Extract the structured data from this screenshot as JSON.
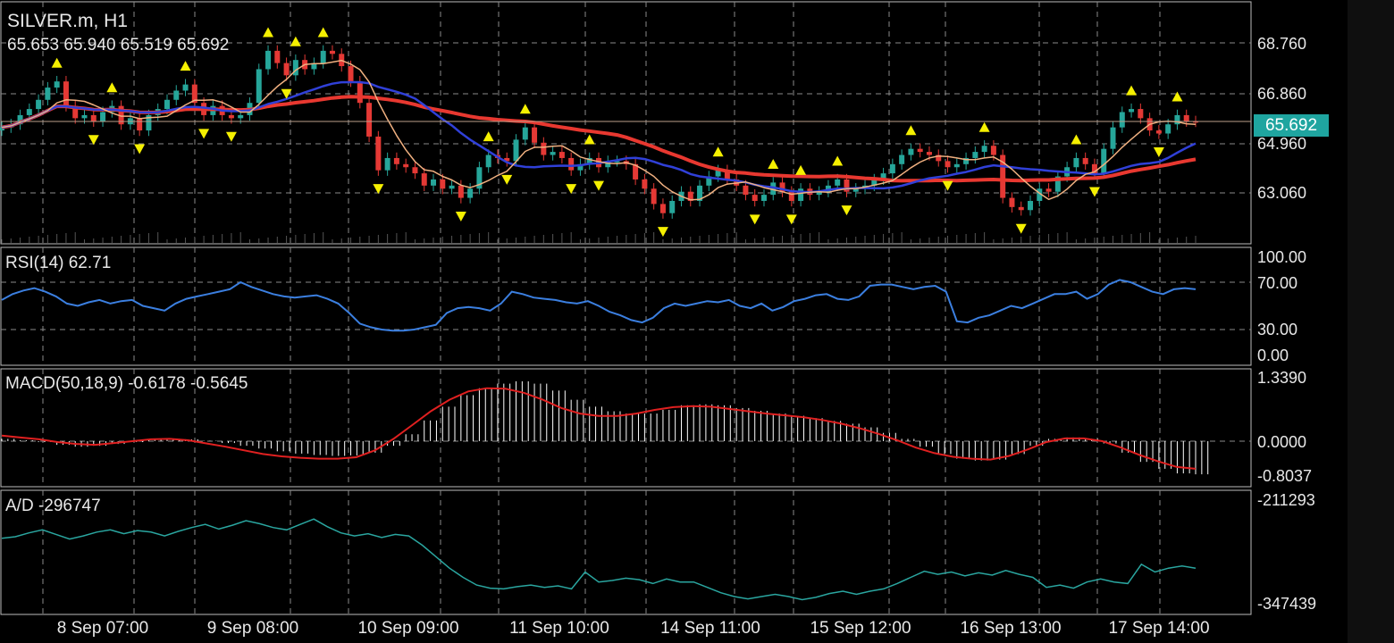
{
  "window": {
    "symbol": "SILVER.m, H1",
    "ohlc": "65.653 65.940 65.519 65.692"
  },
  "colors": {
    "background": "#000000",
    "grid": "#8a8a8a",
    "price_label_bg": "#1fa5a0",
    "rsi": "#3b7fe0",
    "macd_signal": "#e02020",
    "macd_hist": "#ffffff",
    "ad": "#2aa6a0",
    "ma_fast": "#f0b080",
    "ma_mid": "#3040d8",
    "ma_slow": "#e83830",
    "fractal": "#f5f000"
  },
  "main_panel": {
    "y_ticks": [
      "68.760",
      "66.860",
      "64.960",
      "63.060"
    ],
    "current_price": "65.692",
    "x_ticks": [
      "8 Sep 07:00",
      "9 Sep 08:00",
      "10 Sep 09:00",
      "11 Sep 10:00",
      "14 Sep 11:00",
      "15 Sep 12:00",
      "16 Sep 13:00",
      "17 Sep 14:00"
    ]
  },
  "rsi_panel": {
    "label": "RSI(14) 62.71",
    "y_ticks": [
      "100.00",
      "70.00",
      "30.00",
      "0.00"
    ]
  },
  "macd_panel": {
    "label": "MACD(50,18,9) -0.6178 -0.5645",
    "y_ticks": [
      "1.3390",
      "0.0000",
      "-0.8037"
    ]
  },
  "ad_panel": {
    "label": "A/D -296747",
    "y_ticks": [
      "-211293",
      "-347439"
    ]
  },
  "chart_data": {
    "type": "candlestick",
    "price_close": [
      65.5,
      65.6,
      65.9,
      66.1,
      66.4,
      66.8,
      67.0,
      66.2,
      65.8,
      65.9,
      65.7,
      66.0,
      66.2,
      65.6,
      65.8,
      65.4,
      65.9,
      66.1,
      66.4,
      66.7,
      66.9,
      66.3,
      65.9,
      66.2,
      65.9,
      65.8,
      65.9,
      66.3,
      67.4,
      68.0,
      67.6,
      67.2,
      67.7,
      67.4,
      67.6,
      68.0,
      67.9,
      67.5,
      67.0,
      66.3,
      65.2,
      64.1,
      64.5,
      64.3,
      64.2,
      64.0,
      63.6,
      63.8,
      63.5,
      63.6,
      63.2,
      63.5,
      64.2,
      64.6,
      64.5,
      64.4,
      65.1,
      65.5,
      65.0,
      64.6,
      64.7,
      64.5,
      64.1,
      64.3,
      64.5,
      64.2,
      64.4,
      64.4,
      64.3,
      63.8,
      63.5,
      63.0,
      62.7,
      63.1,
      63.4,
      63.1,
      63.6,
      63.9,
      64.1,
      63.8,
      63.6,
      63.3,
      63.1,
      63.3,
      63.7,
      63.4,
      63.1,
      63.5,
      63.3,
      63.4,
      63.6,
      63.8,
      63.4,
      63.5,
      63.6,
      63.8,
      64.0,
      64.3,
      64.6,
      64.8,
      64.7,
      64.6,
      64.4,
      64.2,
      64.3,
      64.5,
      64.7,
      64.9,
      64.6,
      63.2,
      62.9,
      62.8,
      63.1,
      63.5,
      63.4,
      63.9,
      64.2,
      64.5,
      64.3,
      64.0,
      64.8,
      65.5,
      66.0,
      66.1,
      65.8,
      65.4,
      65.3,
      65.6,
      65.9,
      65.7,
      65.69
    ],
    "rsi": [
      55,
      60,
      63,
      65,
      62,
      58,
      52,
      50,
      53,
      55,
      52,
      54,
      55,
      50,
      48,
      46,
      52,
      56,
      58,
      60,
      62,
      64,
      70,
      66,
      63,
      60,
      58,
      57,
      58,
      59,
      56,
      52,
      44,
      35,
      32,
      30,
      29,
      29,
      30,
      32,
      34,
      44,
      48,
      49,
      48,
      46,
      52,
      62,
      60,
      57,
      56,
      55,
      53,
      52,
      54,
      50,
      45,
      42,
      38,
      36,
      40,
      48,
      52,
      50,
      52,
      54,
      53,
      55,
      50,
      48,
      52,
      46,
      49,
      54,
      56,
      59,
      60,
      56,
      55,
      58,
      67,
      68,
      68,
      66,
      64,
      66,
      67,
      62,
      37,
      36,
      40,
      42,
      46,
      50,
      48,
      52,
      56,
      60,
      60,
      62,
      56,
      60,
      68,
      72,
      70,
      66,
      62,
      60,
      64,
      65,
      64
    ],
    "macd_hist": [
      0.05,
      0.02,
      -0.02,
      -0.08,
      -0.12,
      -0.1,
      -0.06,
      -0.02,
      0.03,
      0.05,
      0.04,
      0.01,
      -0.04,
      -0.1,
      -0.16,
      -0.22,
      -0.27,
      -0.3,
      -0.32,
      -0.31,
      -0.25,
      -0.1,
      0.15,
      0.45,
      0.75,
      1.0,
      1.15,
      1.25,
      1.3,
      1.25,
      1.1,
      0.9,
      0.75,
      0.65,
      0.6,
      0.6,
      0.68,
      0.78,
      0.8,
      0.78,
      0.72,
      0.66,
      0.6,
      0.55,
      0.5,
      0.44,
      0.38,
      0.3,
      0.18,
      0.05,
      -0.12,
      -0.28,
      -0.38,
      -0.42,
      -0.4,
      -0.28,
      -0.1,
      0.05,
      0.08,
      0.05,
      -0.05,
      -0.25,
      -0.45,
      -0.6,
      -0.7,
      -0.72
    ],
    "macd_signal": [
      0.12,
      0.08,
      0.04,
      -0.02,
      -0.06,
      -0.08,
      -0.04,
      0.0,
      0.04,
      0.05,
      0.02,
      -0.05,
      -0.12,
      -0.2,
      -0.28,
      -0.33,
      -0.36,
      -0.38,
      -0.38,
      -0.35,
      -0.2,
      0.05,
      0.35,
      0.65,
      0.9,
      1.08,
      1.15,
      1.14,
      1.05,
      0.9,
      0.72,
      0.6,
      0.55,
      0.55,
      0.6,
      0.68,
      0.74,
      0.76,
      0.75,
      0.7,
      0.65,
      0.6,
      0.56,
      0.52,
      0.46,
      0.38,
      0.28,
      0.16,
      0.02,
      -0.14,
      -0.26,
      -0.34,
      -0.38,
      -0.4,
      -0.32,
      -0.18,
      -0.02,
      0.06,
      0.06,
      0.0,
      -0.14,
      -0.3,
      -0.44,
      -0.56,
      -0.6
    ],
    "ad": [
      -261000,
      -259000,
      -254000,
      -250000,
      -256000,
      -262000,
      -258000,
      -253000,
      -250000,
      -255000,
      -251000,
      -253000,
      -258000,
      -252000,
      -247000,
      -243000,
      -249000,
      -244000,
      -238000,
      -242000,
      -247000,
      -250000,
      -243000,
      -236000,
      -246000,
      -254000,
      -258000,
      -255000,
      -260000,
      -256000,
      -258000,
      -270000,
      -285000,
      -300000,
      -312000,
      -322000,
      -326000,
      -327000,
      -324000,
      -322000,
      -325000,
      -323000,
      -327000,
      -305000,
      -318000,
      -316000,
      -313000,
      -315000,
      -320000,
      -314000,
      -318000,
      -318000,
      -325000,
      -332000,
      -337000,
      -340000,
      -337000,
      -334000,
      -337000,
      -341000,
      -338000,
      -333000,
      -330000,
      -334000,
      -330000,
      -327000,
      -320000,
      -312000,
      -304000,
      -308000,
      -305000,
      -310000,
      -306000,
      -309000,
      -303000,
      -308000,
      -312000,
      -325000,
      -322000,
      -326000,
      -318000,
      -314000,
      -318000,
      -320000,
      -295000,
      -305000,
      -300000,
      -297000,
      -300000
    ]
  }
}
